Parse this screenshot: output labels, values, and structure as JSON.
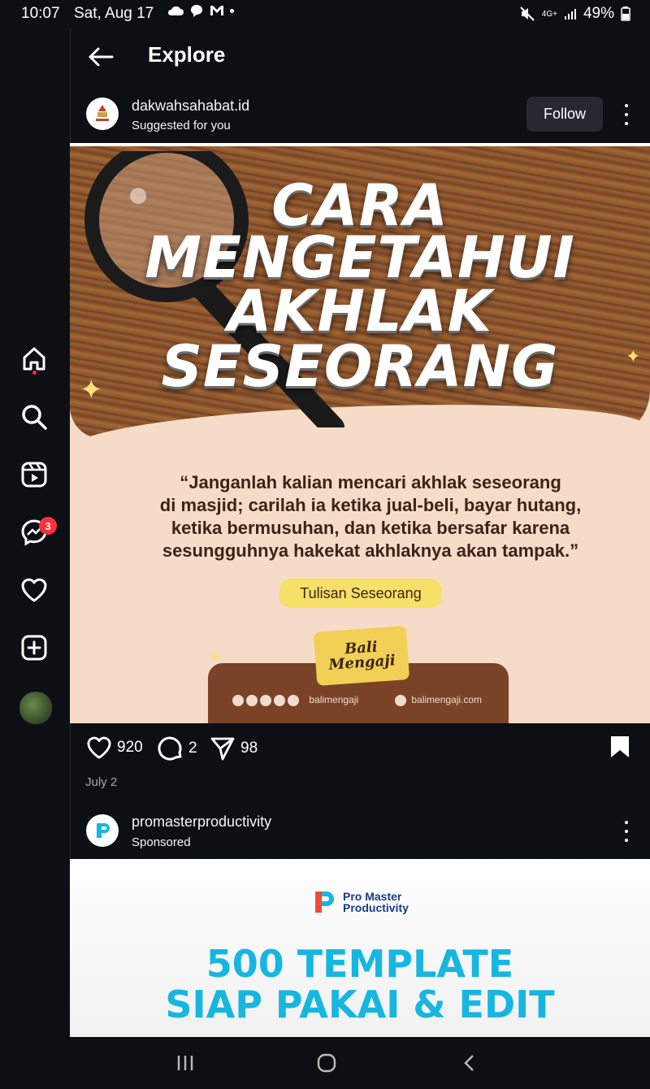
{
  "status_bar": {
    "time": "10:07",
    "date": "Sat, Aug 17",
    "network": "4G+",
    "battery": "49%"
  },
  "sidebar": {
    "items": [
      {
        "icon": "home-icon"
      },
      {
        "icon": "search-icon"
      },
      {
        "icon": "reels-icon"
      },
      {
        "icon": "messenger-icon",
        "badge": "3"
      },
      {
        "icon": "heart-icon"
      },
      {
        "icon": "create-icon"
      },
      {
        "icon": "profile-avatar"
      }
    ]
  },
  "header": {
    "title": "Explore"
  },
  "post1": {
    "username": "dakwahsahabat.id",
    "subtitle": "Suggested for you",
    "follow_label": "Follow",
    "image": {
      "headline": [
        "CARA",
        "MENGETAHUI",
        "AKHLAK",
        "SESEORANG"
      ],
      "quote": [
        "“Janganlah kalian mencari akhlak seseorang",
        "di masjid; carilah ia ketika jual-beli, bayar hutang,",
        "ketika bermusuhan, dan ketika bersafar karena",
        "sesungguhnya hakekat akhlaknya akan tampak.”"
      ],
      "tag": "Tulisan Seseorang",
      "brand": "Bali Mengaji",
      "social_handle": "balimengaji",
      "website": "balimengaji.com"
    },
    "likes": "920",
    "comments": "2",
    "shares": "98",
    "date": "July 2"
  },
  "post2": {
    "username": "promasterproductivity",
    "subtitle": "Sponsored",
    "image": {
      "brand_line1": "Pro Master",
      "brand_line2": "Productivity",
      "line1": "500 TEMPLATE",
      "line2": "SIAP PAKAI & EDIT"
    }
  },
  "colors": {
    "background": "#0c1014",
    "badge": "#ff3040",
    "follow_button": "#262a30",
    "ad_accent": "#17b6e0"
  }
}
